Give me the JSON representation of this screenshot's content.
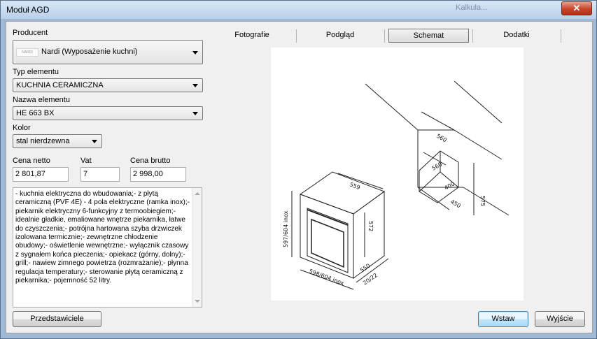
{
  "window": {
    "title": "Moduł AGD",
    "background_title": "Kalkula..."
  },
  "form": {
    "producer_label": "Producent",
    "producer_logo_text": "NARDI",
    "producer_value": "Nardi (Wyposażenie kuchni)",
    "type_label": "Typ elementu",
    "type_value": "KUCHNIA CERAMICZNA",
    "name_label": "Nazwa elementu",
    "name_value": "HE 663 BX",
    "color_label": "Kolor",
    "color_value": "stal nierdzewna",
    "net_label": "Cena netto",
    "net_value": "2 801,87",
    "vat_label": "Vat",
    "vat_value": "7",
    "gross_label": "Cena brutto",
    "gross_value": "2 998,00",
    "description": "- kuchnia elektryczna do wbudowania;- z płytą ceramiczną (PVF 4E) - 4 pola elektryczne (ramka inox);- piekarnik elektryczny 6-funkcyjny z termoobiegiem;- idealnie gładkie, emaliowane wnętrze piekarnika, łatwe do   czyszczenia;- potrójna hartowana szyba drzwiczek izolowana termicznie;- zewnętrzne chłodzenie obudowy;- oświetlenie wewnętrzne;- wyłącznik czasowy z sygnałem końca pieczenia;- opiekacz (górny, dolny);- grill;- nawiew zimnego powietrza (rozmrażanie);- płynna regulacja temperatury;- sterowanie płytą ceramiczną z piekarnika;- pojemność 52 litry."
  },
  "tabs": [
    {
      "label": "Fotografie",
      "active": false
    },
    {
      "label": "Podgląd",
      "active": false
    },
    {
      "label": "Schemat",
      "active": true
    },
    {
      "label": "Dodatki",
      "active": false
    }
  ],
  "diagram": {
    "labels": [
      "560",
      "560",
      "400",
      "450",
      "575",
      "559",
      "572",
      "597/604 inox",
      "598/604 inox",
      "550",
      "20/22"
    ]
  },
  "buttons": {
    "representatives": "Przedstawiciele",
    "insert": "Wstaw",
    "exit": "Wyjście"
  },
  "colors": {
    "titlebar": "#c9dcf0",
    "client": "#f0f0f0",
    "default_button": "#bee6fd"
  }
}
